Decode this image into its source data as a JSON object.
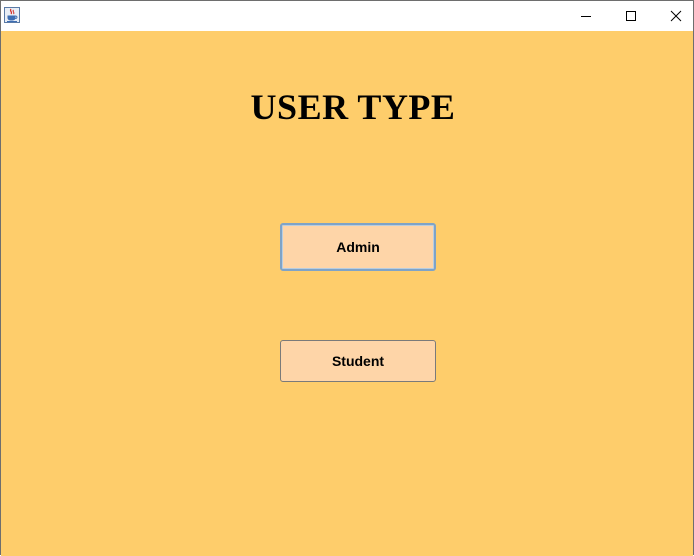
{
  "window": {
    "app_icon": "java-cup-icon",
    "controls": {
      "minimize_icon": "minimize-icon",
      "maximize_icon": "maximize-icon",
      "close_icon": "close-icon"
    }
  },
  "main": {
    "title": "USER TYPE",
    "buttons": {
      "admin_label": "Admin",
      "student_label": "Student"
    }
  },
  "colors": {
    "background": "#fecd6b",
    "button_fill": "#fed5a8",
    "focus_border": "#7fa3c7"
  }
}
